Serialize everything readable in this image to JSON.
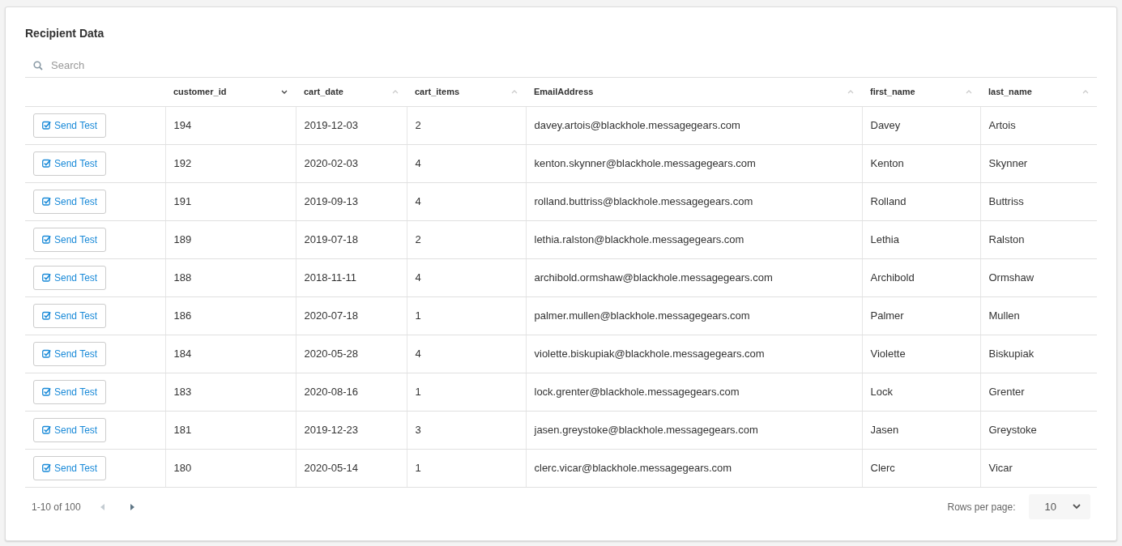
{
  "title": "Recipient Data",
  "search": {
    "placeholder": "Search"
  },
  "table": {
    "columns": [
      {
        "kind": "blank"
      },
      {
        "kind": "sortable",
        "label": "customer_id",
        "sorted": true
      },
      {
        "kind": "sortable",
        "label": "cart_date",
        "sorted": false
      },
      {
        "kind": "sortable",
        "label": "cart_items",
        "sorted": false
      },
      {
        "kind": "sortable",
        "label": "EmailAddress",
        "sorted": false
      },
      {
        "kind": "sortable",
        "label": "first_name",
        "sorted": false
      },
      {
        "kind": "sortable",
        "label": "last_name",
        "sorted": false
      }
    ],
    "rows": [
      {
        "cells": [
          "Send Test",
          "194",
          "2019-12-03",
          "2",
          "davey.artois@blackhole.messagegears.com",
          "Davey",
          "Artois"
        ]
      },
      {
        "cells": [
          "Send Test",
          "192",
          "2020-02-03",
          "4",
          "kenton.skynner@blackhole.messagegears.com",
          "Kenton",
          "Skynner"
        ]
      },
      {
        "cells": [
          "Send Test",
          "191",
          "2019-09-13",
          "4",
          "rolland.buttriss@blackhole.messagegears.com",
          "Rolland",
          "Buttriss"
        ]
      },
      {
        "cells": [
          "Send Test",
          "189",
          "2019-07-18",
          "2",
          "lethia.ralston@blackhole.messagegears.com",
          "Lethia",
          "Ralston"
        ]
      },
      {
        "cells": [
          "Send Test",
          "188",
          "2018-11-11",
          "4",
          "archibold.ormshaw@blackhole.messagegears.com",
          "Archibold",
          "Ormshaw"
        ]
      },
      {
        "cells": [
          "Send Test",
          "186",
          "2020-07-18",
          "1",
          "palmer.mullen@blackhole.messagegears.com",
          "Palmer",
          "Mullen"
        ]
      },
      {
        "cells": [
          "Send Test",
          "184",
          "2020-05-28",
          "4",
          "violette.biskupiak@blackhole.messagegears.com",
          "Violette",
          "Biskupiak"
        ]
      },
      {
        "cells": [
          "Send Test",
          "183",
          "2020-08-16",
          "1",
          "lock.grenter@blackhole.messagegears.com",
          "Lock",
          "Grenter"
        ]
      },
      {
        "cells": [
          "Send Test",
          "181",
          "2019-12-23",
          "3",
          "jasen.greystoke@blackhole.messagegears.com",
          "Jasen",
          "Greystoke"
        ]
      },
      {
        "cells": [
          "Send Test",
          "180",
          "2020-05-14",
          "1",
          "clerc.vicar@blackhole.messagegears.com",
          "Clerc",
          "Vicar"
        ]
      }
    ]
  },
  "pagination": {
    "range": "1-10 of 100",
    "prev_disabled": true,
    "next_disabled": false,
    "rows_per_page_label": "Rows per page:",
    "rows_per_page": "10"
  }
}
